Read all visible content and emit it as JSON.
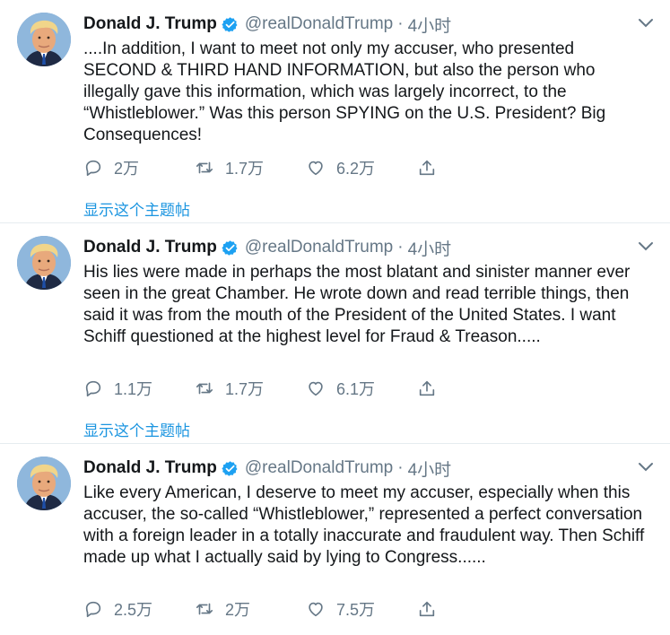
{
  "colors": {
    "link": "#1b95e0",
    "muted": "#657786",
    "text": "#14171a",
    "divider": "#e6ecf0",
    "verified": "#1da1f2"
  },
  "icons": [
    "verified-badge-icon",
    "chevron-down-icon",
    "reply-icon",
    "retweet-icon",
    "like-icon",
    "share-icon"
  ],
  "tweets": [
    {
      "name": "Donald J. Trump",
      "handle": "@realDonaldTrump",
      "separator": "·",
      "time": "4小时",
      "text": "....In addition, I want to meet not only my accuser, who presented SECOND & THIRD HAND INFORMATION, but also the person who illegally gave this information, which was largely incorrect, to the “Whistleblower.” Was this person SPYING on the U.S. President? Big Consequences!",
      "replies": "2万",
      "retweets": "1.7万",
      "likes": "6.2万",
      "thread_link": "显示这个主题帖"
    },
    {
      "name": "Donald J. Trump",
      "handle": "@realDonaldTrump",
      "separator": "·",
      "time": "4小时",
      "text": "His lies were made in perhaps the most blatant and sinister manner ever seen in the great Chamber. He wrote down and read terrible things, then said it was from the mouth of the President of the United States. I want Schiff questioned at the highest level for Fraud & Treason.....",
      "replies": "1.1万",
      "retweets": "1.7万",
      "likes": "6.1万",
      "thread_link": "显示这个主题帖"
    },
    {
      "name": "Donald J. Trump",
      "handle": "@realDonaldTrump",
      "separator": "·",
      "time": "4小时",
      "text": "Like every American, I deserve to meet my accuser, especially when this accuser, the so-called “Whistleblower,” represented a perfect conversation with a foreign leader in a totally inaccurate and fraudulent way. Then Schiff made up what I actually said by lying to Congress......",
      "replies": "2.5万",
      "retweets": "2万",
      "likes": "7.5万"
    }
  ]
}
